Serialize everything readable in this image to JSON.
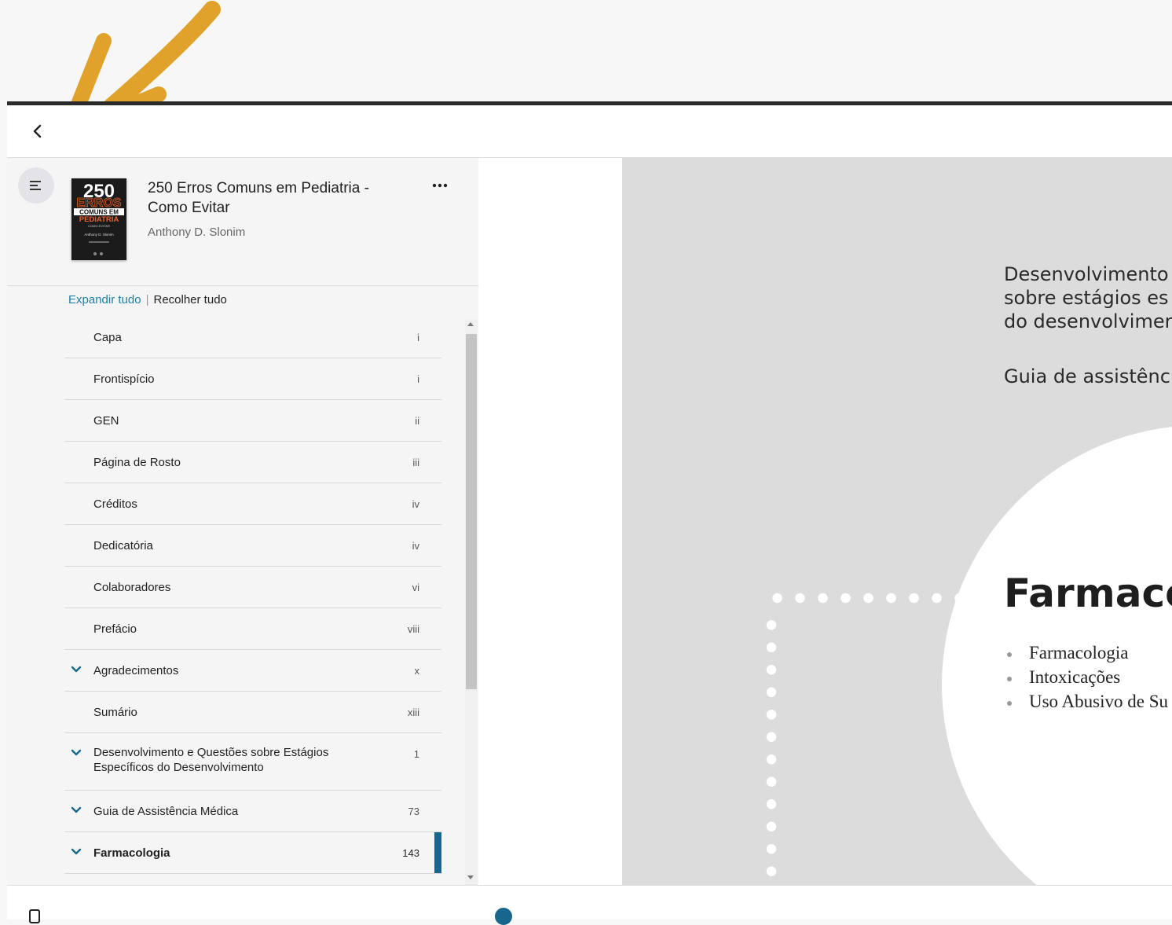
{
  "book": {
    "title": "250 Erros Comuns em Pediatria - Como Evitar",
    "author": "Anthony D. Slonim",
    "cover_text": {
      "number": "250",
      "line1": "COMUNS EM",
      "line2": "PEDIATRIA",
      "subtitle": "COMO EVITAR",
      "authors": "Anthony D. Slonim"
    }
  },
  "toc_controls": {
    "expand_all": "Expandir tudo",
    "separator": "|",
    "collapse_all": "Recolher tudo"
  },
  "toc": [
    {
      "label": "Capa",
      "page": "i",
      "expandable": false
    },
    {
      "label": "Frontispício",
      "page": "i",
      "expandable": false
    },
    {
      "label": "GEN",
      "page": "ii",
      "expandable": false
    },
    {
      "label": "Página de Rosto",
      "page": "iii",
      "expandable": false
    },
    {
      "label": "Créditos",
      "page": "iv",
      "expandable": false
    },
    {
      "label": "Dedicatória",
      "page": "iv",
      "expandable": false
    },
    {
      "label": "Colaboradores",
      "page": "vi",
      "expandable": false
    },
    {
      "label": "Prefácio",
      "page": "viii",
      "expandable": false
    },
    {
      "label": "Agradecimentos",
      "page": "x",
      "expandable": true
    },
    {
      "label": "Sumário",
      "page": "xiii",
      "expandable": false
    },
    {
      "label": "Desenvolvimento e Questões sobre Estágios Específicos do Desenvolvimento",
      "page": "1",
      "expandable": true
    },
    {
      "label": "Guia de Assistência Médica",
      "page": "73",
      "expandable": true
    },
    {
      "label": "Farmacologia",
      "page": "143",
      "expandable": true,
      "active": true
    }
  ],
  "page_content": {
    "lines": [
      "Desenvolvimento",
      "sobre estágios es",
      "do desenvolvimer"
    ],
    "line4": "Guia de assistênc",
    "chapter_title": "Farmaco",
    "topics": [
      "Farmacologia",
      "Intoxicações",
      "Uso Abusivo de Su"
    ]
  },
  "icons": {
    "back": "chevron-left-icon",
    "menu": "menu-icon",
    "more": "more-horizontal-icon",
    "chevron": "chevron-down-icon",
    "annotation": "arrow-annotation-icon"
  },
  "colors": {
    "accent": "#16678b",
    "link": "#1b7fa6",
    "annotation_arrow": "#e0a22a",
    "page_bg": "#dcdcdc"
  }
}
